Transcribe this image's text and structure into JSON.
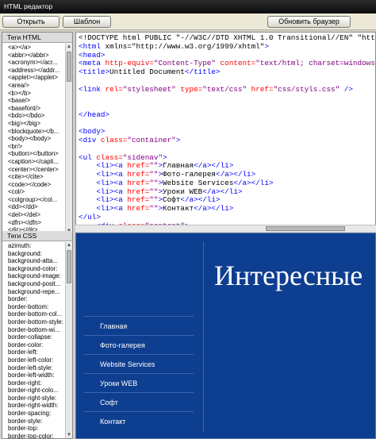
{
  "window": {
    "title": "HTML редактор"
  },
  "toolbar": {
    "open_label": "Открыть",
    "template_label": "Шаблон",
    "refresh_label": "Обновить браузер"
  },
  "html_tags": {
    "header": "Теги HTML",
    "items": [
      "<a></a>",
      "<abbr></abbr>",
      "<acronym></acr...",
      "<address></addr...",
      "<applet></applet>",
      "<area/>",
      "<b></b>",
      "<base/>",
      "<basefont/>",
      "<bdo></bdo>",
      "<big></big>",
      "<blockquote></b...",
      "<body></body>",
      "<br/>",
      "<button></button>",
      "<caption></capti...",
      "<center></center>",
      "<cite></cite>",
      "<code></code>",
      "<col/>",
      "<colgroup></col...",
      "<dd></dd>",
      "<del></del>",
      "<dfn></dfn>",
      "<dir></dir>"
    ]
  },
  "css_tags": {
    "header": "Теги CSS",
    "items": [
      "azimuth:",
      "background:",
      "background-atta...",
      "background-color:",
      "background-image:",
      "background-posit...",
      "background-repe...",
      "border:",
      "border-bottom:",
      "border-bottom-col...",
      "border-bottom-style:",
      "border-bottom-wi...",
      "border-collapse:",
      "border-color:",
      "border-left:",
      "border-left-color:",
      "border-left-style:",
      "border-left-width:",
      "border-right:",
      "border-right-colo...",
      "border-right-style:",
      "border-right-width:",
      "border-spacing:",
      "border-style:",
      "border-top:",
      "border-top-color:",
      "border-top-style:"
    ]
  },
  "code_lines": [
    [
      [
        "t",
        "<!DOCTYPE html PUBLIC \"-//W3C//DTD XHTML 1.0 Transitional//EN\" \"http://"
      ]
    ],
    [
      [
        "k",
        "<html "
      ],
      [
        "t",
        "xmlns=\"http://www.w3.org/1999/xhtml\""
      ],
      [
        "k",
        ">"
      ]
    ],
    [
      [
        "k",
        "<head>"
      ]
    ],
    [
      [
        "k",
        "<meta "
      ],
      [
        "a",
        "http-equiv="
      ],
      [
        "s",
        "\"Content-Type\" "
      ],
      [
        "a",
        "content="
      ],
      [
        "s",
        "\"text/html; charset=windows-125"
      ]
    ],
    [
      [
        "k",
        "<title>"
      ],
      [
        "t",
        "Untitled Document"
      ],
      [
        "k",
        "</title>"
      ]
    ],
    [],
    [
      [
        "k",
        "<link "
      ],
      [
        "a",
        "rel="
      ],
      [
        "s",
        "\"stylesheet\" "
      ],
      [
        "a",
        "type="
      ],
      [
        "s",
        "\"text/css\" "
      ],
      [
        "a",
        "href="
      ],
      [
        "s",
        "\"css/styls.css\" "
      ],
      [
        "k",
        "/>"
      ]
    ],
    [],
    [],
    [
      [
        "k",
        "</head>"
      ]
    ],
    [],
    [
      [
        "k",
        "<body>"
      ]
    ],
    [
      [
        "k",
        "<div "
      ],
      [
        "a",
        "class="
      ],
      [
        "s",
        "\"container\""
      ],
      [
        "k",
        ">"
      ]
    ],
    [],
    [
      [
        "k",
        "<ul "
      ],
      [
        "a",
        "class="
      ],
      [
        "s",
        "\"sidenav\""
      ],
      [
        "k",
        ">"
      ]
    ],
    [
      [
        "k",
        "    <li><a "
      ],
      [
        "a",
        "href="
      ],
      [
        "s",
        "\"\""
      ],
      [
        "k",
        ">"
      ],
      [
        "t",
        "Главная"
      ],
      [
        "k",
        "</a></li>"
      ]
    ],
    [
      [
        "k",
        "    <li><a "
      ],
      [
        "a",
        "href="
      ],
      [
        "s",
        "\"\""
      ],
      [
        "k",
        ">"
      ],
      [
        "t",
        "Фото-галерея"
      ],
      [
        "k",
        "</a></li>"
      ]
    ],
    [
      [
        "k",
        "    <li><a "
      ],
      [
        "a",
        "href="
      ],
      [
        "s",
        "\"\""
      ],
      [
        "k",
        ">"
      ],
      [
        "t",
        "Website Services"
      ],
      [
        "k",
        "</a></li>"
      ]
    ],
    [
      [
        "k",
        "    <li><a "
      ],
      [
        "a",
        "href="
      ],
      [
        "s",
        "\"\""
      ],
      [
        "k",
        ">"
      ],
      [
        "t",
        "Уроки WEB"
      ],
      [
        "k",
        "</a></li>"
      ]
    ],
    [
      [
        "k",
        "    <li><a "
      ],
      [
        "a",
        "href="
      ],
      [
        "s",
        "\"\""
      ],
      [
        "k",
        ">"
      ],
      [
        "t",
        "Софт"
      ],
      [
        "k",
        "</a></li>"
      ]
    ],
    [
      [
        "k",
        "    <li><a "
      ],
      [
        "a",
        "href="
      ],
      [
        "s",
        "\"\""
      ],
      [
        "k",
        ">"
      ],
      [
        "t",
        "Контакт"
      ],
      [
        "k",
        "</a></li>"
      ]
    ],
    [
      [
        "k",
        "</ul>"
      ]
    ],
    [
      [
        "k",
        "    <div "
      ],
      [
        "a",
        "class="
      ],
      [
        "s",
        "\"content\""
      ],
      [
        "k",
        ">"
      ]
    ]
  ],
  "code_colors": {
    "k": "#0000ff",
    "a": "#ff0000",
    "s": "#800080",
    "t": "#000000"
  },
  "preview": {
    "title": "Интересные",
    "nav": [
      "Главная",
      "Фото-галерея",
      "Website Services",
      "Уроки WEB",
      "Софт",
      "Контакт"
    ],
    "background_color": "#0e3e8f"
  }
}
